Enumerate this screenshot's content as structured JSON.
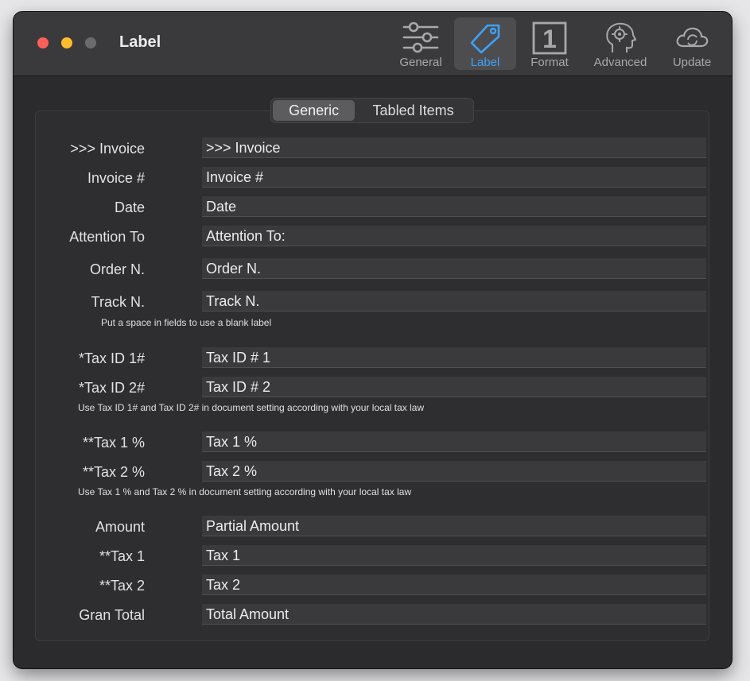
{
  "window": {
    "title": "Label"
  },
  "toolbar": {
    "general": "General",
    "label": "Label",
    "format": "Format",
    "format_glyph": "1",
    "advanced": "Advanced",
    "update": "Update"
  },
  "tabs": {
    "generic": "Generic",
    "tabled": "Tabled Items"
  },
  "rows": [
    {
      "label": ">>> Invoice",
      "value": ">>> Invoice"
    },
    {
      "label": "Invoice #",
      "value": "Invoice #"
    },
    {
      "label": "Date",
      "value": "Date"
    },
    {
      "label": "Attention To",
      "value": "Attention To:"
    },
    {
      "label": "Order N.",
      "value": "Order N."
    },
    {
      "label": "Track N.",
      "value": "Track N."
    },
    {
      "label": "*Tax ID 1#",
      "value": "Tax ID # 1"
    },
    {
      "label": "*Tax ID 2#",
      "value": "Tax ID # 2"
    },
    {
      "label": "**Tax 1 %",
      "value": "Tax 1 %"
    },
    {
      "label": "**Tax 2 %",
      "value": "Tax 2 %"
    },
    {
      "label": "Amount",
      "value": "Partial Amount"
    },
    {
      "label": "**Tax 1",
      "value": "Tax 1"
    },
    {
      "label": "**Tax 2",
      "value": "Tax 2"
    },
    {
      "label": "Gran Total",
      "value": "Total Amount"
    }
  ],
  "hints": {
    "blank": "Put a space in fields to use a blank label",
    "taxid": "Use Tax ID 1# and Tax ID 2#  in document setting according with your local tax law",
    "taxpct": "Use Tax 1 % and Tax 2 %  in document setting according with your local tax law"
  },
  "colors": {
    "accent": "#3ea1f6",
    "close": "#ff5f57",
    "minimize": "#febc2e",
    "zoom_inactive": "#6b6b6d"
  },
  "icons": {
    "general": "sliders-icon",
    "label": "tag-icon",
    "format": "number-one-box-icon",
    "advanced": "gear-head-icon",
    "update": "cloud-sync-icon"
  }
}
